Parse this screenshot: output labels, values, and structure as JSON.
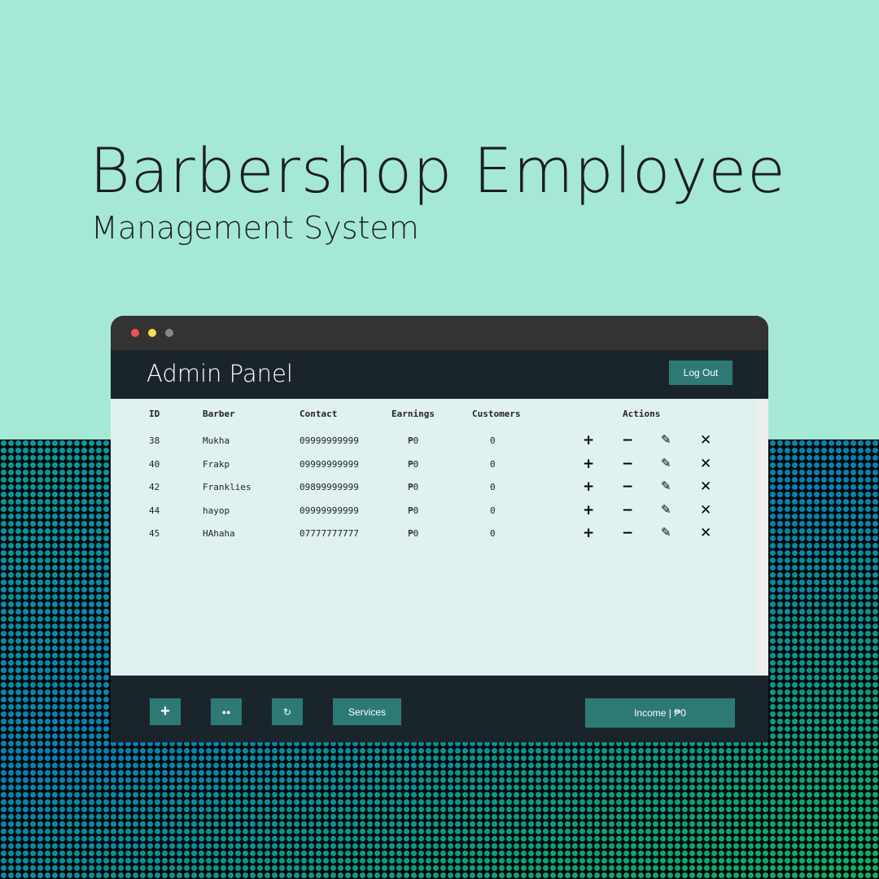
{
  "hero": {
    "title": "Barbershop Employee",
    "subtitle": "Management System"
  },
  "window": {
    "title": "Admin Panel",
    "logout": "Log Out"
  },
  "table": {
    "headers": [
      "ID",
      "Barber",
      "Contact",
      "Earnings",
      "Customers",
      "Actions"
    ],
    "rows": [
      {
        "id": "38",
        "barber": "Mukha",
        "contact": "09999999999",
        "earnings": "₱0",
        "customers": "0"
      },
      {
        "id": "40",
        "barber": "Frakp",
        "contact": "09999999999",
        "earnings": "₱0",
        "customers": "0"
      },
      {
        "id": "42",
        "barber": "Franklies",
        "contact": "09899999999",
        "earnings": "₱0",
        "customers": "0"
      },
      {
        "id": "44",
        "barber": "hayop",
        "contact": "09999999999",
        "earnings": "₱0",
        "customers": "0"
      },
      {
        "id": "45",
        "barber": "HAhaha",
        "contact": "07777777777",
        "earnings": "₱0",
        "customers": "0"
      }
    ],
    "actions": {
      "add": "+",
      "minus": "−",
      "edit": "✎",
      "delete": "✕"
    }
  },
  "footer": {
    "add": "+",
    "view": "●●",
    "refresh": "↻",
    "services": "Services",
    "income": "Income | ₱0"
  },
  "colors": {
    "accent": "#2d7a75",
    "dark": "#1a252b",
    "panel": "#dff2f0",
    "bg": "#a6e8d6"
  }
}
